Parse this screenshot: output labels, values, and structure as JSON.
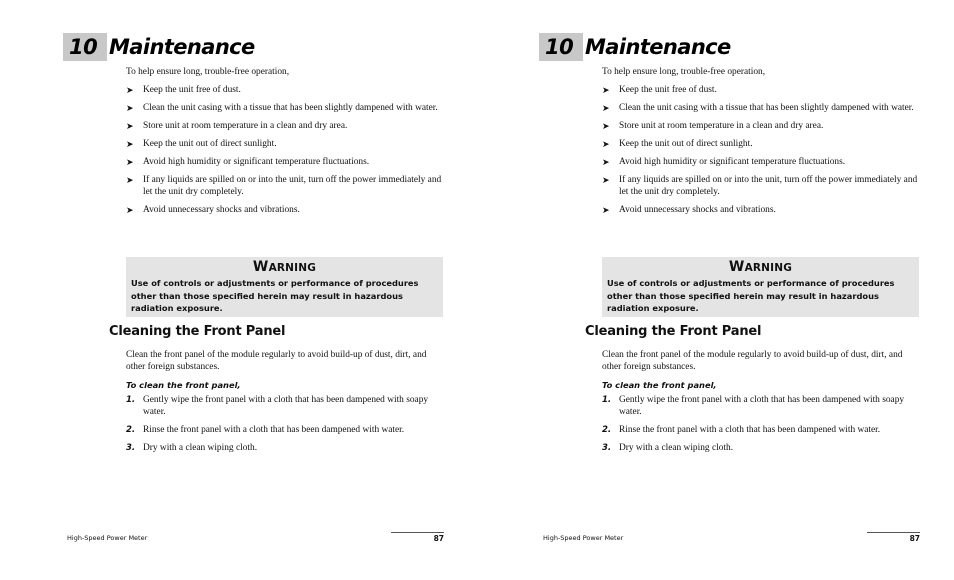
{
  "pages": [
    {
      "chapter": {
        "number": "10",
        "title": "Maintenance"
      },
      "intro": "To help ensure long, trouble-free operation,",
      "bullets": [
        "Keep the unit free of dust.",
        "Clean the unit casing with a tissue that has been slightly dampened with water.",
        "Store unit at room temperature in a clean and dry area.",
        "Keep the unit out of direct sunlight.",
        "Avoid high humidity or significant temperature fluctuations.",
        "If any liquids are spilled on or into the unit, turn off the power immediately and let the unit dry completely.",
        "Avoid unnecessary shocks and vibrations."
      ],
      "bullet_icon": "➤",
      "warning": {
        "title_first": "W",
        "title_rest": "ARNING",
        "text": "Use of controls or adjustments or performance of procedures other than those specified herein may result in hazardous radiation exposure."
      },
      "section": {
        "title": "Cleaning the Front Panel",
        "body": "Clean the front panel of the module regularly to avoid build-up of dust, dirt, and other foreign substances.",
        "procedure_title": "To clean the front panel,",
        "steps": [
          {
            "num": "1.",
            "text": "Gently wipe the front panel with a cloth that has been dampened with soapy water."
          },
          {
            "num": "2.",
            "text": "Rinse the front panel with a cloth that has been dampened with water."
          },
          {
            "num": "3.",
            "text": "Dry with a clean wiping cloth."
          }
        ]
      },
      "footer": {
        "product": "High-Speed Power Meter",
        "page_number": "87"
      }
    },
    {
      "chapter": {
        "number": "10",
        "title": "Maintenance"
      },
      "intro": "To help ensure long, trouble-free operation,",
      "bullets": [
        "Keep the unit free of dust.",
        "Clean the unit casing with a tissue that has been slightly dampened with water.",
        "Store unit at room temperature in a clean and dry area.",
        "Keep the unit out of direct sunlight.",
        "Avoid high humidity or significant temperature fluctuations.",
        "If any liquids are spilled on or into the unit, turn off the power immediately and let the unit dry completely.",
        "Avoid unnecessary shocks and vibrations."
      ],
      "bullet_icon": "➤",
      "warning": {
        "title_first": "W",
        "title_rest": "ARNING",
        "text": "Use of controls or adjustments or performance of procedures other than those specified herein may result in hazardous radiation exposure."
      },
      "section": {
        "title": "Cleaning the Front Panel",
        "body": "Clean the front panel of the module regularly to avoid build-up of dust, dirt, and other foreign substances.",
        "procedure_title": "To clean the front panel,",
        "steps": [
          {
            "num": "1.",
            "text": "Gently wipe the front panel with a cloth that has been dampened with soapy water."
          },
          {
            "num": "2.",
            "text": "Rinse the front panel with a cloth that has been dampened with water."
          },
          {
            "num": "3.",
            "text": "Dry with a clean wiping cloth."
          }
        ]
      },
      "footer": {
        "product": "High-Speed Power Meter",
        "page_number": "87"
      }
    }
  ],
  "colors": {
    "chapter_box": "#c8c8c8",
    "warning_box": "#e4e4e4"
  }
}
